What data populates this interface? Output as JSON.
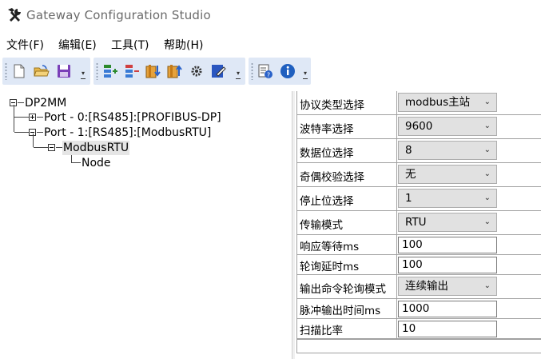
{
  "window": {
    "title": "Gateway Configuration Studio",
    "icon": "hammer-wrench-icon"
  },
  "menu": [
    {
      "label": "文件(F)"
    },
    {
      "label": "编辑(E)"
    },
    {
      "label": "工具(T)"
    },
    {
      "label": "帮助(H)"
    }
  ],
  "toolbar": {
    "groups": [
      {
        "buttons": [
          "new-file-icon",
          "open-folder-icon",
          "save-icon"
        ]
      },
      {
        "buttons": [
          "add-port-icon",
          "remove-port-icon",
          "download-icon",
          "upload-icon",
          "settings-gear-icon",
          "edit-config-icon"
        ]
      },
      {
        "buttons": [
          "help-document-icon",
          "info-icon"
        ]
      }
    ]
  },
  "tree": {
    "root": "DP2MM",
    "port0": "Port - 0:[RS485]:[PROFIBUS-DP]",
    "port1": "Port - 1:[RS485]:[ModbusRTU]",
    "modbus": "ModbusRTU",
    "node": "Node"
  },
  "properties": [
    {
      "label": "协议类型选择",
      "type": "combo",
      "value": "modbus主站"
    },
    {
      "label": "波特率选择",
      "type": "combo",
      "value": "9600"
    },
    {
      "label": "数据位选择",
      "type": "combo",
      "value": "8"
    },
    {
      "label": "奇偶校验选择",
      "type": "combo",
      "value": "无"
    },
    {
      "label": "停止位选择",
      "type": "combo",
      "value": "1"
    },
    {
      "label": "传输模式",
      "type": "combo",
      "value": "RTU"
    },
    {
      "label": "响应等待ms",
      "type": "text",
      "value": "100"
    },
    {
      "label": "轮询延时ms",
      "type": "text",
      "value": "100"
    },
    {
      "label": "输出命令轮询模式",
      "type": "combo",
      "value": "连续输出"
    },
    {
      "label": "脉冲输出时间ms",
      "type": "text",
      "value": "1000"
    },
    {
      "label": "扫描比率",
      "type": "text",
      "value": "10"
    }
  ]
}
